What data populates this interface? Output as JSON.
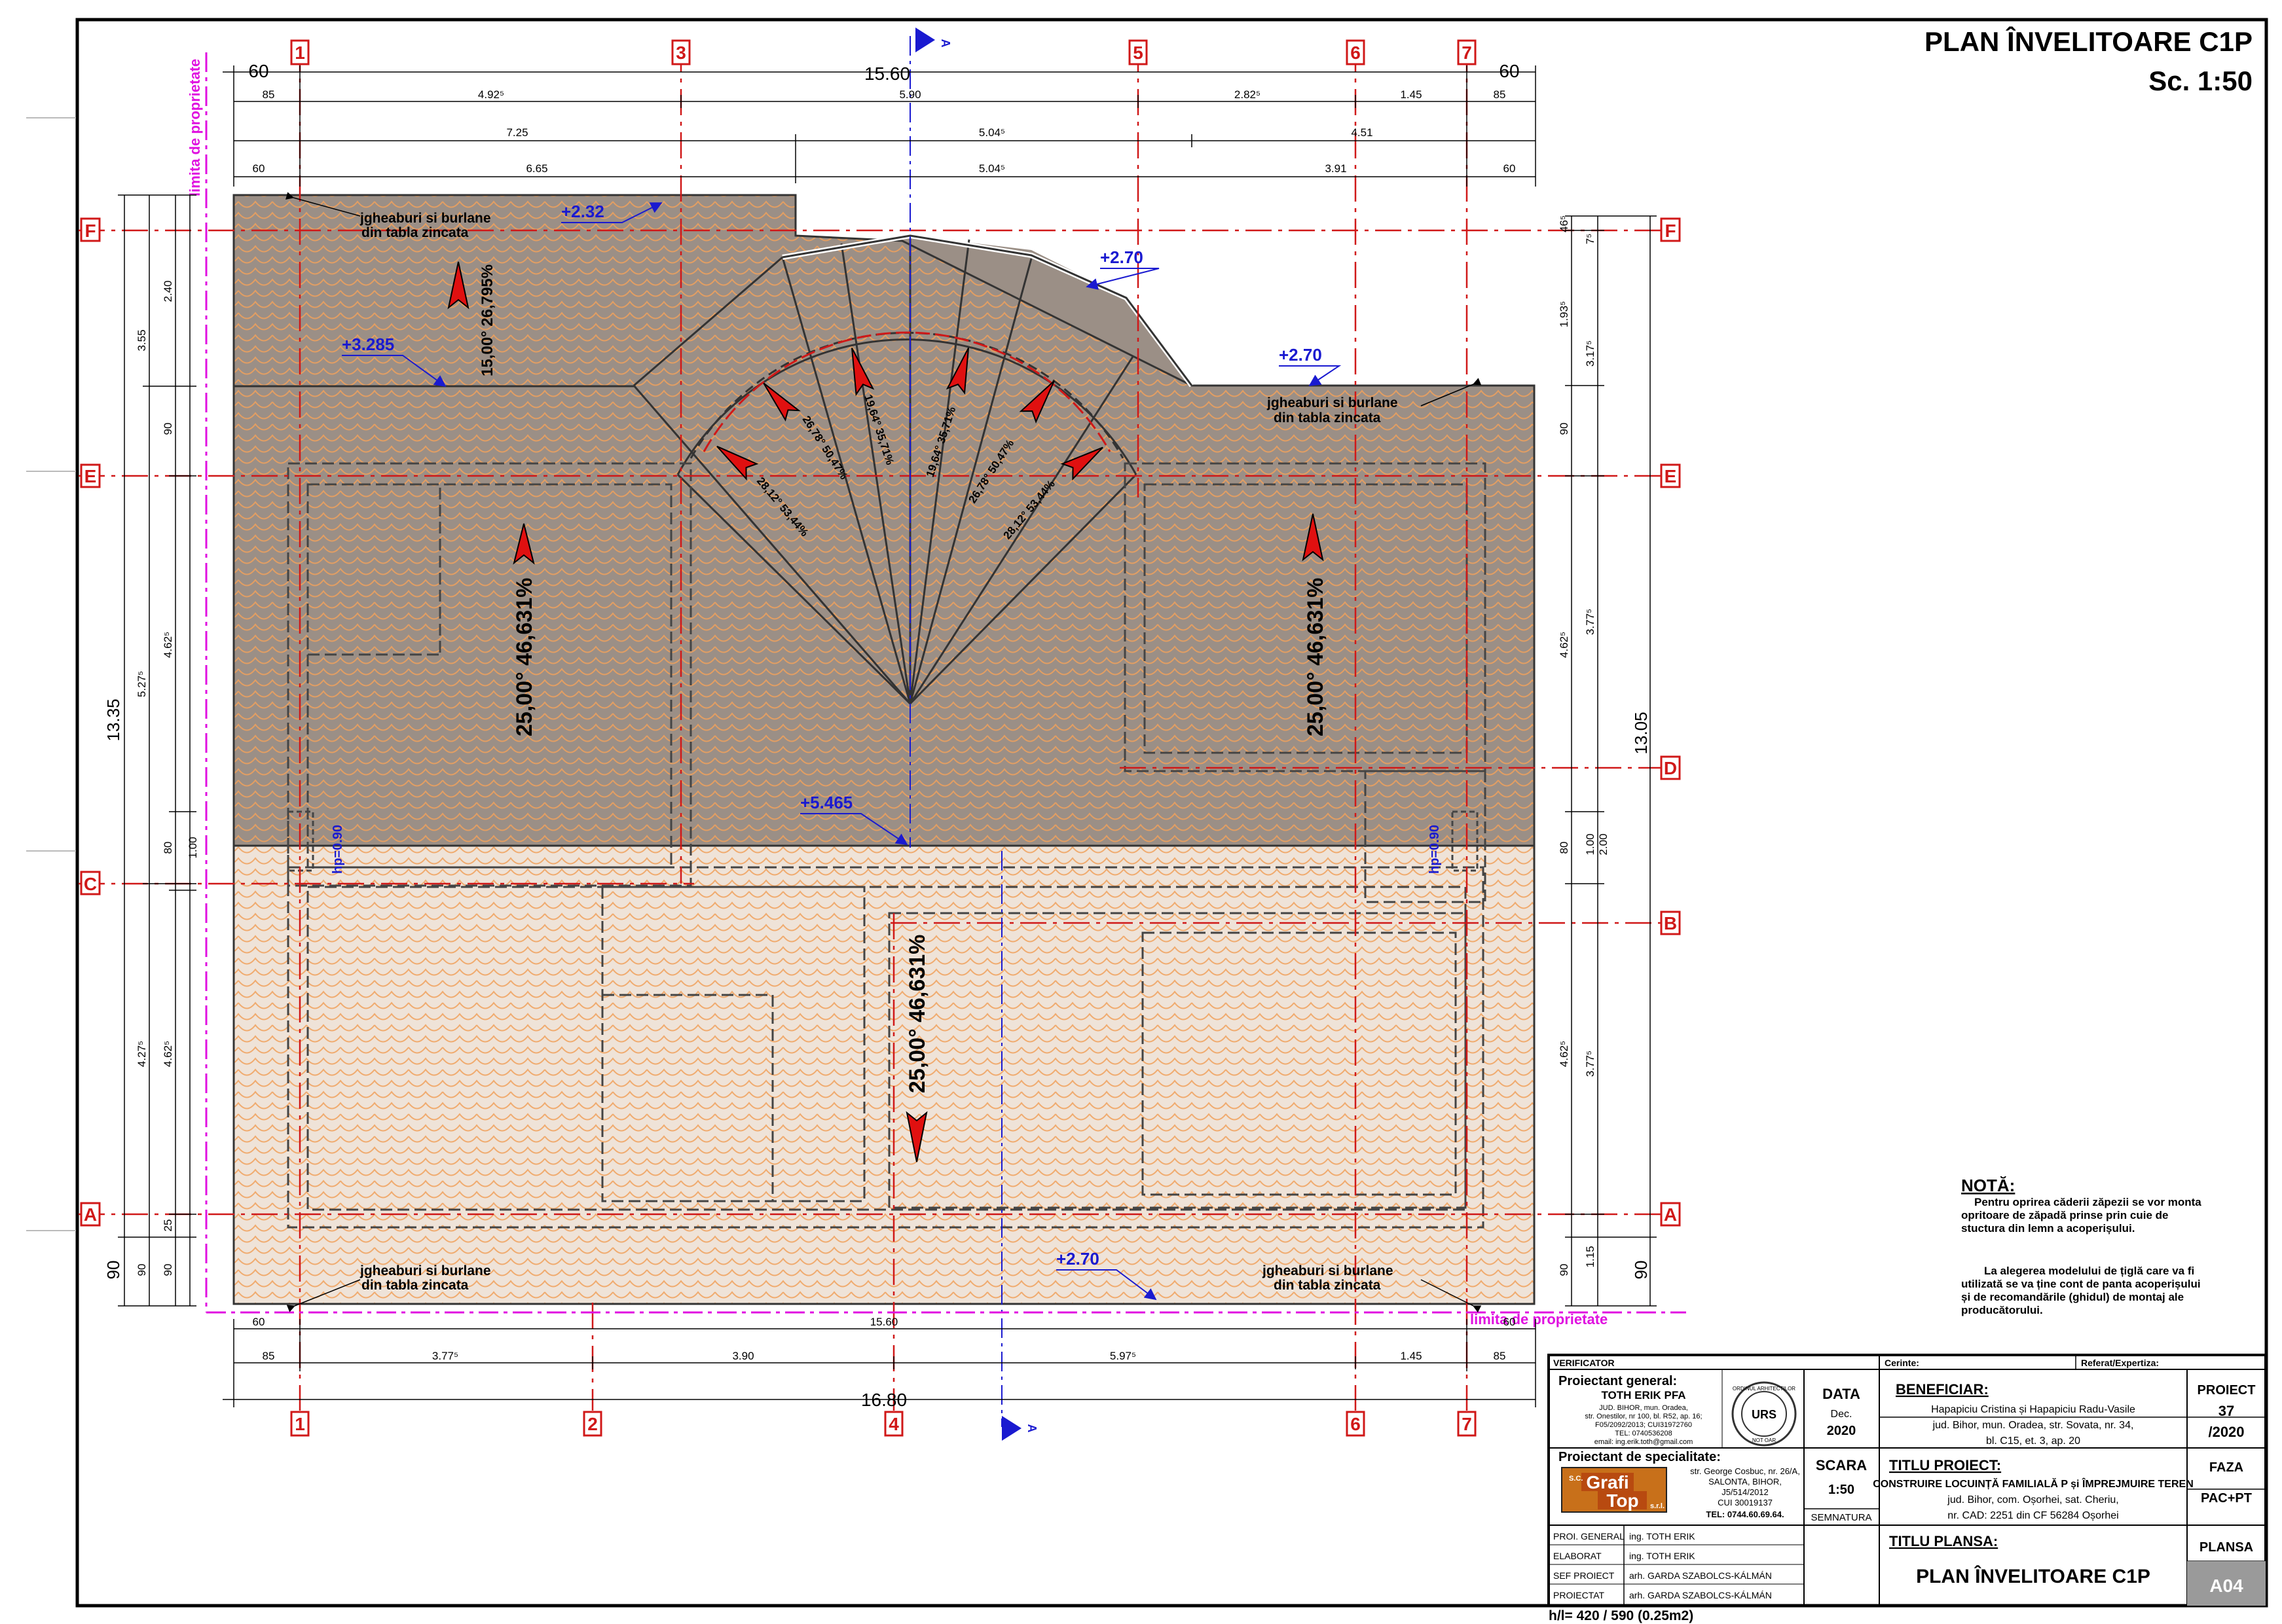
{
  "sheet": {
    "title": "PLAN ÎNVELITOARE C1P",
    "scale": "Sc. 1:50",
    "property_limit": "limita de proprietate",
    "size_note": "h/l= 420 / 590 (0.25m2)"
  },
  "axes": {
    "vertical": [
      "1",
      "2",
      "3",
      "4",
      "5",
      "6",
      "7"
    ],
    "horizontal": [
      "A",
      "B",
      "C",
      "D",
      "E",
      "F"
    ],
    "section_marker": "A"
  },
  "dims": {
    "top_overall": "15.60",
    "top_side": "60",
    "top_row1": [
      "85",
      "4.92⁵",
      "5.90",
      "2.82⁵",
      "1.45",
      "85"
    ],
    "top_row2": [
      "7.25",
      "5.04⁵",
      "4.51"
    ],
    "top_row3": [
      "60",
      "6.65",
      "5.04⁵",
      "3.91",
      "60"
    ],
    "bottom_row1": [
      "60",
      "15.60",
      "60"
    ],
    "bottom_row2": [
      "85",
      "3.77⁵",
      "3.90",
      "5.97⁵",
      "1.45",
      "85"
    ],
    "bottom_overall": "16.80",
    "left_overall": "13.35",
    "left_side": "90",
    "left_col1": [
      "3.55",
      "5.27⁵",
      "4.27⁵",
      "90"
    ],
    "left_col2": [
      "2.40",
      "90",
      "4.62⁵",
      "80",
      "4.62⁵",
      "25",
      "90"
    ],
    "left_col3": [
      "1.00",
      "90"
    ],
    "right_overall": "13.05",
    "right_side": "90",
    "right_col1": [
      "46⁵",
      "1.93⁵",
      "90",
      "4.62⁵",
      "80",
      "4.62⁵",
      "90"
    ],
    "right_col2": [
      "7⁵",
      "3.17⁵",
      "3.77⁵",
      "1.00",
      "2.00",
      "3.77⁵",
      "1.15"
    ]
  },
  "roof": {
    "slopes": [
      "25,00° 46,631%",
      "25,00° 46,631%",
      "25,00° 46,631%",
      "15,00° 26,795%",
      "28,12° 53,44%",
      "26,78° 50,47%",
      "19,64° 35,71%",
      "19,64° 35,71%",
      "26,78° 50,47%",
      "28,12° 53,44%"
    ],
    "levels": [
      "+2.32",
      "+3.285",
      "+2.70",
      "+2.70",
      "+5.465",
      "+2.70"
    ],
    "gutters_line1": "jgheaburi si burlane",
    "gutters_line2": "din tabla zincata",
    "hp": "hp=0.90"
  },
  "note": {
    "title": "NOTĂ:",
    "p1": [
      "Pentru oprirea căderii zăpezii se vor monta",
      "opritoare de zăpadă prinse prin cuie de",
      "stuctura din lemn a acoperișului."
    ],
    "p2": [
      "La alegerea modelului de țiglă care va fi",
      "utilizată se va ține cont de panta acoperișului",
      "și  de  recomandările (ghidul)  de montaj  ale",
      "producătorului."
    ]
  },
  "titleblock": {
    "verificator": "VERIFICATOR",
    "cerinte": "Cerinte:",
    "referat": "Referat/Expertiza:",
    "gen_label": "Proiectant general:",
    "gen_name": "TOTH ERIK PFA",
    "gen_info": [
      "JUD. BIHOR, mun. Oradea,",
      "str. Onestilor, nr 100, bl. R52, ap. 16;",
      "F05/2092/2013; CUI31972760",
      "TEL: 0740536208",
      "email: ing.erik.toth@gmail.com"
    ],
    "spec_label": "Proiectant de specialitate:",
    "spec_logo": [
      "Grafi",
      "Top",
      "S.C.",
      "s.r.l."
    ],
    "spec_info": [
      "str. George Cosbuc, nr. 26/A,",
      "SALONTA, BIHOR,",
      "J5/514/2012",
      "CUI 30019137",
      "TEL: 0744.60.69.64."
    ],
    "stamp": [
      "ORDINUL ARHITECTILOR",
      "URS",
      "NOT OAR"
    ],
    "data_label": "DATA",
    "data_month": "Dec.",
    "data_year": "2020",
    "scara_label": "SCARA",
    "scara_value": "1:50",
    "semnatura": "SEMNATURA",
    "beneficiar_label": "BENEFICIAR:",
    "beneficiar": [
      "Hapapiciu Cristina și Hapapiciu Radu-Vasile",
      "jud. Bihor, mun. Oradea, str. Sovata, nr. 34,",
      "bl. C15, et. 3, ap. 20"
    ],
    "titlu_proiect_label": "TITLU PROIECT:",
    "titlu_proiect": [
      "CONSTRUIRE LOCUINȚĂ FAMILIALĂ P și ÎMPREJMUIRE TEREN",
      "jud. Bihor, com. Oșorhei, sat. Cheriu,",
      "nr. CAD: 2251 din CF 56284 Oșorhei"
    ],
    "titlu_plansa_label": "TITLU PLANSA:",
    "titlu_plansa": "PLAN ÎNVELITOARE C1P",
    "proiect_label": "PROIECT",
    "proiect_value": "37",
    "proiect_year": "/2020",
    "faza_label": "FAZA",
    "faza_value": "PAC+PT",
    "plansa_label": "PLANSA",
    "plansa_value": "A04",
    "roles": [
      "PROI. GENERAL",
      "ELABORAT",
      "SEF PROIECT",
      "PROIECTAT"
    ],
    "names": [
      "ing. TOTH ERIK",
      "ing. TOTH ERIK",
      "arh. GARDA SZABOLCS-KÁLMÁN",
      "arh. GARDA SZABOLCS-KÁLMÁN"
    ]
  },
  "colors": {
    "roof_dark": "#9b8f86",
    "roof_light": "#efe3d8",
    "tile": "#f0a15c",
    "axis": "#d01818",
    "property": "#e010e0",
    "level": "#1a1ad0"
  }
}
